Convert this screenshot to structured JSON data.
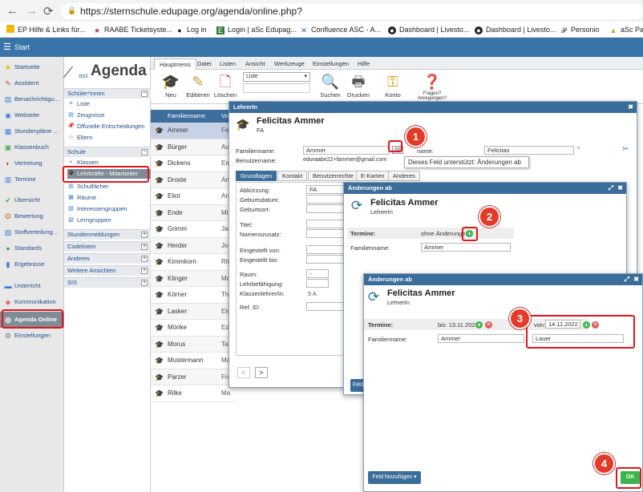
{
  "browser": {
    "url": "https://sternschule.edupage.org/agenda/online.php?",
    "bookmarks": [
      "EP Hilfe & Links für...",
      "RAABE Ticketsyste...",
      "Log in",
      "Login | aSc Edupag...",
      "Confluence ASC - A...",
      "Dashboard | Livesto...",
      "Dashboard | Livesto...",
      "Personio",
      "aSc Par"
    ]
  },
  "header": {
    "title": "Start"
  },
  "sidebar": {
    "items": [
      {
        "label": "Startseite",
        "icon": "star-icon",
        "color": "#f2b705"
      },
      {
        "label": "Assistent",
        "icon": "wand-icon",
        "color": "#d44"
      },
      {
        "label": "Benachrichtigu...",
        "icon": "bell-icon",
        "color": "#3a7bd5"
      },
      {
        "label": "Webseite",
        "icon": "globe-icon",
        "color": "#3a7bd5"
      },
      {
        "label": "Stundenpläne ...",
        "icon": "grid-icon",
        "color": "#3a7bd5"
      },
      {
        "label": "Klassenbuch",
        "icon": "book-icon",
        "color": "#5a5"
      },
      {
        "label": "Vertretung",
        "icon": "swap-icon",
        "color": "#d44"
      },
      {
        "label": "Termine",
        "icon": "calendar-icon",
        "color": "#3a7bd5"
      },
      {
        "label": "Übersicht",
        "icon": "check-icon",
        "color": "#3bb54a"
      },
      {
        "label": "Bewertung",
        "icon": "rating-icon",
        "color": "#e67e22"
      },
      {
        "label": "Stoffverteilung...",
        "icon": "chart-icon",
        "color": "#3a7bd5"
      },
      {
        "label": "Standards",
        "icon": "standards-icon",
        "color": "#3bb54a"
      },
      {
        "label": "Ergebnisse",
        "icon": "results-icon",
        "color": "#3a7bd5"
      },
      {
        "label": "Unterricht",
        "icon": "lesson-icon",
        "color": "#3a7bd5"
      },
      {
        "label": "Kommunikation",
        "icon": "chat-icon",
        "color": "#d44"
      },
      {
        "label": "Agenda Online",
        "icon": "agenda-icon",
        "color": "#fff"
      },
      {
        "label": "Einstellungen",
        "icon": "gear-icon",
        "color": "#777"
      }
    ]
  },
  "tree": {
    "logo_prefix": "asc",
    "logo_text": "Agenda",
    "sections": {
      "schueler": "Schüler*innen",
      "schule": "Schule",
      "stundenmeldungen": "Stundenmeldungen",
      "codelisten": "Codelisten",
      "anderes": "Anderes",
      "weitere": "Weitere Ansichten",
      "sis": "SIS"
    },
    "schueler_items": [
      "Liste",
      "Zeugnisse",
      "Offizielle Entscheidungen",
      "Eltern"
    ],
    "schule_items": [
      "Klassen",
      "Lehrkräfte - Mitarbeiter",
      "Schulfächer",
      "Räume",
      "Interessengruppen",
      "Lerngruppen"
    ]
  },
  "toolbar": {
    "tabs": [
      "Hauptmenü",
      "Datei",
      "Listen",
      "Ansicht",
      "Werkzeuge",
      "Einstellungen",
      "Hilfe"
    ],
    "buttons": [
      "Neu",
      "Editieren",
      "Löschen",
      "Suchen",
      "Drucken",
      "Konto",
      "Fragen? Anregungen?"
    ],
    "list_select": "Liste"
  },
  "table": {
    "header": "Familienname",
    "header2": "Vo",
    "rows": [
      {
        "name": "Ammer",
        "vn": "Feli"
      },
      {
        "name": "Bürger",
        "vn": "Aug"
      },
      {
        "name": "Dickens",
        "vn": "Em"
      },
      {
        "name": "Droste",
        "vn": "Ann"
      },
      {
        "name": "Eliot",
        "vn": "Ann"
      },
      {
        "name": "Ende",
        "vn": "Mic"
      },
      {
        "name": "Grimm",
        "vn": "Jac"
      },
      {
        "name": "Herder",
        "vn": "Joh"
      },
      {
        "name": "Kimmkorn",
        "vn": "Rita"
      },
      {
        "name": "Klinger",
        "vn": "Ma"
      },
      {
        "name": "Körner",
        "vn": "The"
      },
      {
        "name": "Lasker",
        "vn": "Els"
      },
      {
        "name": "Mörike",
        "vn": "Edu"
      },
      {
        "name": "Morus",
        "vn": "Tan"
      },
      {
        "name": "Mustermann",
        "vn": "Ma"
      },
      {
        "name": "Parzer",
        "vn": "Fra"
      },
      {
        "name": "Rilke",
        "vn": "Ma"
      }
    ]
  },
  "teacher_dialog": {
    "title": "LehrerIn",
    "name": "Felicitas Ammer",
    "abbr": "FA",
    "familienname_label": "Familienname:",
    "familienname_value": "Ammer",
    "vorname_label": "name:",
    "vorname_value": "Felicitas",
    "benutzername_label": "Benutzername:",
    "benutzername_value": "eduraabe22+fammer@gmail.com",
    "tooltip": "Dieses Feld unterstützt: Änderungen ab",
    "tabs": [
      "Grundlagen",
      "Kontakt",
      "Benutzerrechte",
      "E-Karten",
      "Anderes"
    ],
    "fields": [
      "Abkürzung:",
      "Geburtsdatum:",
      "Geburtsort:",
      "Titel:",
      "Namenszusatz:",
      "Eingestellt von:",
      "Eingestellt bis:",
      "Raum:",
      "Lehrbefähigung:",
      "Klassenlehrer/in:",
      "Ref. ID:"
    ],
    "abkuerzung_value": "FA",
    "klassenlehrer_value": "5 A",
    "prev": "<",
    "next": ">"
  },
  "change_dialog1": {
    "title": "Änderungen ab",
    "name": "Felicitas Ammer",
    "role": "LehrerIn",
    "termine_label": "Termine:",
    "termine_value": "ohne Änderungen",
    "familienname_label": "Familienname:",
    "familienname_value": "Ammer",
    "button_partial": "Feld"
  },
  "change_dialog2": {
    "title": "Änderungen ab",
    "name": "Felicitas Ammer",
    "role": "LehrerIn",
    "termine_label": "Termine:",
    "bis_label": "bis: 13.11.2022",
    "von_label": "von:",
    "von_value": "14.11.2022",
    "familienname_label": "Familienname:",
    "familienname_old": "Ammer",
    "familienname_new": "Lauer",
    "add_field": "Feld hinzufügen ▾",
    "ok": "OK"
  },
  "annotations": [
    "1",
    "2",
    "3",
    "4"
  ],
  "colors": {
    "accent": "#3b6d9b",
    "highlight": "#e3151b",
    "badge": "#e33b28",
    "ok": "#3bb54a"
  }
}
